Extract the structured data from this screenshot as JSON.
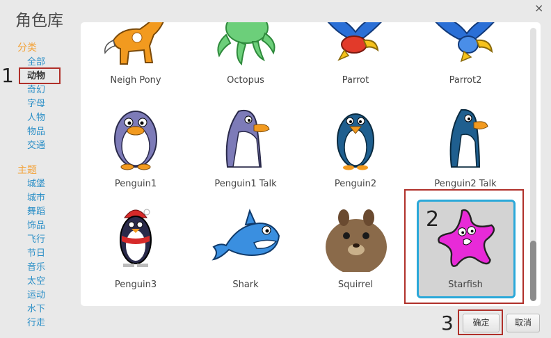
{
  "dialog": {
    "title": "角色库",
    "close_label": "×"
  },
  "sidebar": {
    "category_heading": "分类",
    "categories": [
      "全部",
      "动物",
      "奇幻",
      "字母",
      "人物",
      "物品",
      "交通"
    ],
    "selected_category": "动物",
    "theme_heading": "主题",
    "themes": [
      "城堡",
      "城市",
      "舞蹈",
      "饰品",
      "飞行",
      "节日",
      "音乐",
      "太空",
      "运动",
      "水下",
      "行走"
    ]
  },
  "annotations": {
    "step1": "1",
    "step2": "2",
    "step3": "3"
  },
  "sprites": [
    {
      "name": "Neigh Pony",
      "icon": "pony-icon"
    },
    {
      "name": "Octopus",
      "icon": "octopus-icon"
    },
    {
      "name": "Parrot",
      "icon": "parrot-icon"
    },
    {
      "name": "Parrot2",
      "icon": "parrot-icon"
    },
    {
      "name": "Penguin1",
      "icon": "penguin-icon"
    },
    {
      "name": "Penguin1 Talk",
      "icon": "penguin-icon"
    },
    {
      "name": "Penguin2",
      "icon": "penguin-icon"
    },
    {
      "name": "Penguin2 Talk",
      "icon": "penguin-icon"
    },
    {
      "name": "Penguin3",
      "icon": "penguin-icon"
    },
    {
      "name": "Shark",
      "icon": "shark-icon"
    },
    {
      "name": "Squirrel",
      "icon": "squirrel-icon"
    },
    {
      "name": "Starfish",
      "icon": "starfish-icon"
    }
  ],
  "selected_sprite": "Starfish",
  "buttons": {
    "ok": "确定",
    "cancel": "取消"
  },
  "colors": {
    "accent_orange": "#f3a238",
    "link_blue": "#2b8fc7",
    "highlight_red": "#b0302a",
    "selection_blue": "#2aa8d9"
  }
}
